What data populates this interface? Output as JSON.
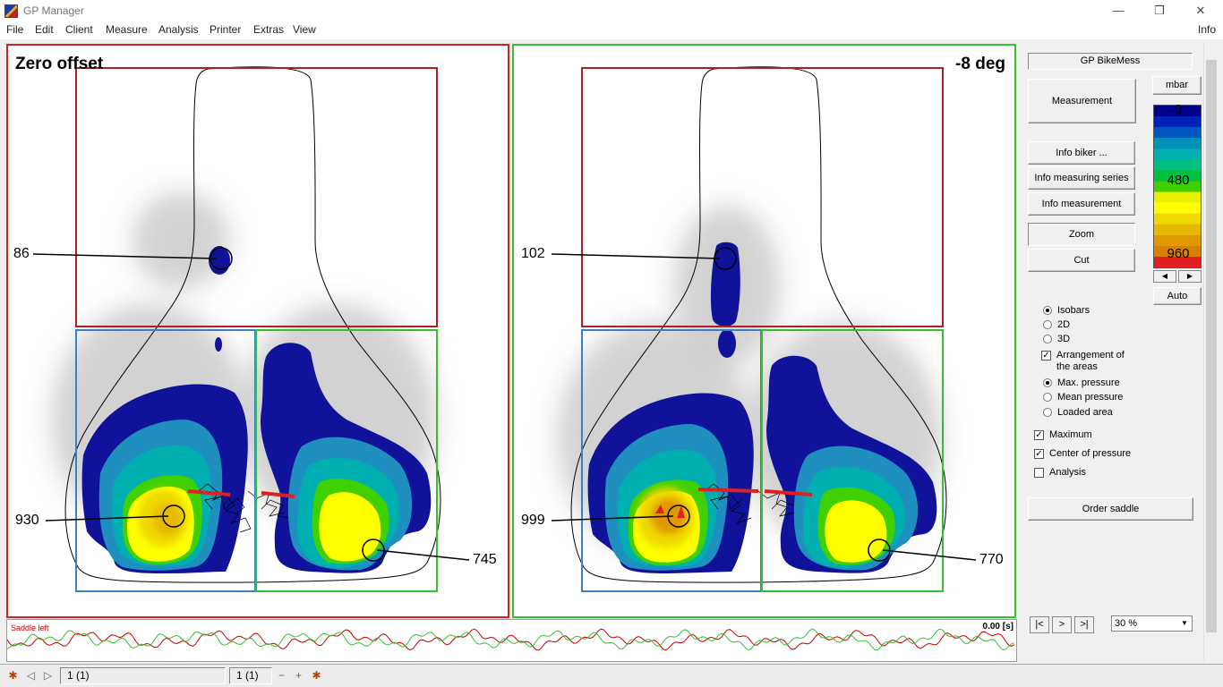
{
  "window": {
    "title": "GP Manager",
    "controls": [
      "—",
      "❐",
      "✕"
    ]
  },
  "menu": {
    "items": [
      "File",
      "Edit",
      "Client",
      "Measure",
      "Analysis",
      "Printer",
      "Extras",
      "View"
    ],
    "info": "Info"
  },
  "panels": [
    {
      "title": "Zero offset",
      "center_value": "86",
      "left_value": "930",
      "right_value": "745",
      "border_color": "#d02020"
    },
    {
      "title": "-8 deg",
      "center_value": "102",
      "left_value": "999",
      "right_value": "770",
      "border_color": "#33c033"
    }
  ],
  "controls": {
    "device_label": "GP BikeMess",
    "measurement_button": "Measurement",
    "info_biker_button": "Info biker ...",
    "info_series_button": "Info measuring series",
    "info_measurement_button": "Info measurement",
    "zoom_button": "Zoom",
    "cut_button": "Cut",
    "order_button": "Order saddle",
    "display_options": [
      {
        "label": "Isobars",
        "type": "radio",
        "checked": true
      },
      {
        "label": "2D",
        "type": "radio",
        "checked": false
      },
      {
        "label": "3D",
        "type": "radio",
        "checked": false
      },
      {
        "label": "Arrangement of the areas",
        "type": "check",
        "checked": true
      }
    ],
    "pressure_options": [
      {
        "label": "Max. pressure",
        "checked": true
      },
      {
        "label": "Mean pressure",
        "checked": false
      },
      {
        "label": "Loaded area",
        "checked": false
      }
    ],
    "checks": [
      {
        "label": "Maximum",
        "checked": true
      },
      {
        "label": "Center of pressure",
        "checked": true
      },
      {
        "label": "Analysis",
        "checked": false
      }
    ]
  },
  "colorbar": {
    "unit": "mbar",
    "ticks": [
      "0",
      "480",
      "960"
    ],
    "auto_label": "Auto",
    "colors": [
      "#00008b",
      "#0022b8",
      "#0055c0",
      "#0090b8",
      "#00b0b0",
      "#00c080",
      "#00c040",
      "#40d000",
      "#e8f000",
      "#ffff00",
      "#f0d800",
      "#e8b800",
      "#e09800",
      "#d88000",
      "#e02020"
    ]
  },
  "trace": {
    "label": "Saddle left",
    "time": "0.00 [s]",
    "colors": [
      "#c00000",
      "#33c033"
    ]
  },
  "playback": {
    "first": "|<",
    "next": ">",
    "last": ">|",
    "zoom": "30 %"
  },
  "status": {
    "frame_left": "1 (1)",
    "frame_right": "1 (1)"
  }
}
